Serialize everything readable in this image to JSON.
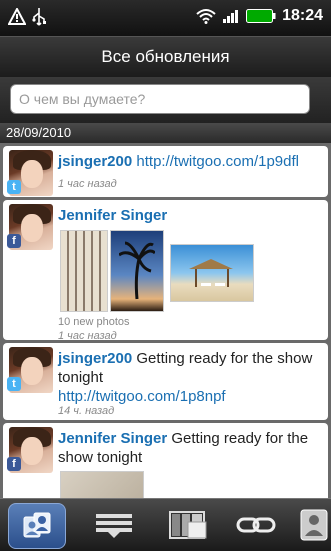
{
  "status": {
    "time": "18:24",
    "icons": [
      "warning-icon",
      "usb-icon",
      "wifi-icon",
      "signal-icon",
      "battery-icon"
    ]
  },
  "header": {
    "title": "Все обновления"
  },
  "search": {
    "placeholder": "О чем вы думаете?"
  },
  "date_header": "28/09/2010",
  "posts": [
    {
      "author": "jsinger200",
      "text": "http://twitgoo.com/1p9dfl",
      "time": "1 час назад",
      "network": "twitter"
    },
    {
      "author": "Jennifer Singer",
      "photos_caption": "10 new photos",
      "time": "1 час назад",
      "network": "facebook"
    },
    {
      "author": "jsinger200",
      "text": "Getting ready for the show tonight",
      "link": "http://twitgoo.com/1p8npf",
      "time": "14 ч. назад",
      "network": "twitter"
    },
    {
      "author": "Jennifer Singer",
      "text": "Getting ready for the show tonight",
      "network": "facebook"
    }
  ],
  "bottom_tabs": [
    {
      "icon": "people-icon",
      "active": true
    },
    {
      "icon": "status-list-icon",
      "active": false
    },
    {
      "icon": "photos-icon",
      "active": false
    },
    {
      "icon": "links-icon",
      "active": false
    },
    {
      "icon": "contact-card-icon",
      "active": false
    }
  ],
  "colors": {
    "link": "#1a6fb2",
    "twitter": "#4ab3f4",
    "facebook": "#3b5998",
    "active_tab": "#3b62a4"
  }
}
